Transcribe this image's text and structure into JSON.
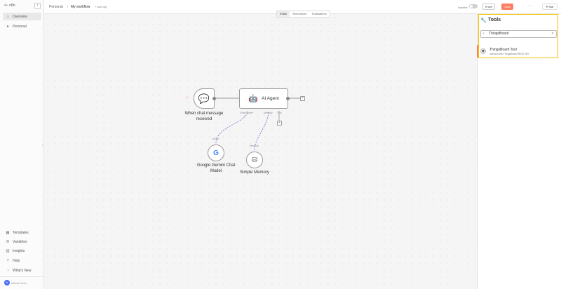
{
  "sidebar": {
    "logo": "n8n",
    "collapse_icon": "‹",
    "items_top": [
      {
        "label": "Overview",
        "icon": "home-icon",
        "glyph": "⌂"
      },
      {
        "label": "Personal",
        "icon": "user-icon",
        "glyph": "👤"
      }
    ],
    "items_bottom": [
      {
        "label": "Templates",
        "icon": "templates-icon",
        "glyph": "▦"
      },
      {
        "label": "Variables",
        "icon": "variables-icon",
        "glyph": "⚙"
      },
      {
        "label": "Insights",
        "icon": "insights-icon",
        "glyph": "▥"
      },
      {
        "label": "Help",
        "icon": "help-icon",
        "glyph": "?"
      },
      {
        "label": "What's New",
        "icon": "bell-icon",
        "glyph": "◔"
      }
    ],
    "user_initials": "N",
    "user_name": "Nikola Davis"
  },
  "header": {
    "crumb_home": "Personal",
    "crumb_sep": "/",
    "workflow_name": "My workflow",
    "add_tag": "+ Add tag",
    "inactive_label": "Inactive",
    "share_label": "Share",
    "save_label": "Save",
    "more_label": "···",
    "star_label": "Star"
  },
  "tabs": [
    "Editor",
    "Executions",
    "Evaluations"
  ],
  "canvas": {
    "trigger_label": "When chat message received",
    "agent_label": "AI Agent",
    "chat_model_port": "Chat Model*",
    "memory_port": "Memory",
    "tool_port": "Tool",
    "model_sublabel": "Model",
    "memory_sublabel": "Memory",
    "gemini_label": "Google Gemini Chat Model",
    "memory_label": "Simple Memory"
  },
  "panel": {
    "title": "Tools",
    "search_value": "ThingsBoard",
    "result_title": "ThingsBoard Tool",
    "result_desc": "Interact with ThingsBoard REST API"
  },
  "colors": {
    "save": "#ff7d62",
    "highlight": "#f2c200",
    "connector": "#7b6ad1"
  }
}
